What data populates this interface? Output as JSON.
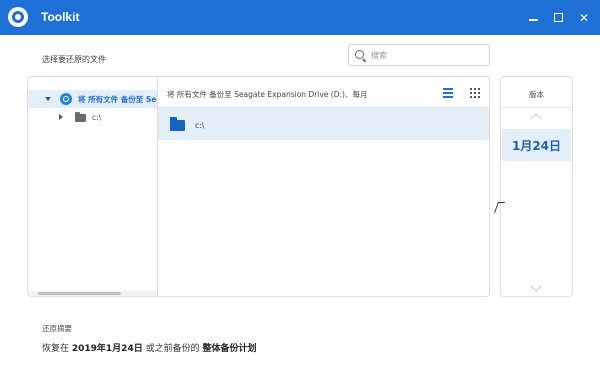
{
  "window": {
    "title": "Toolkit",
    "minimize": "",
    "maximize": "",
    "close": "✕"
  },
  "select_label": "选择要还原的文件",
  "search": {
    "placeholder": "搜索"
  },
  "tree": {
    "root_label": "将 所有文件 备份至 Seagate Expansion Drive (D:)",
    "child_label": "c:\\"
  },
  "file_panel": {
    "header": "将 所有文件 备份至 Seagate Expansion Drive (D:)、每月",
    "rows": [
      {
        "name": "c:\\"
      }
    ]
  },
  "version": {
    "title": "版本",
    "selected_date": "1月24日"
  },
  "summary": {
    "label": "还原摘要",
    "prefix": "恢复在 ",
    "date": "2019年1月24日",
    "middle": " 或之前备份的 ",
    "plan": "整体备份计划"
  },
  "colors": {
    "accent": "#1e6fd6",
    "selected_bg": "#e3eef9"
  }
}
